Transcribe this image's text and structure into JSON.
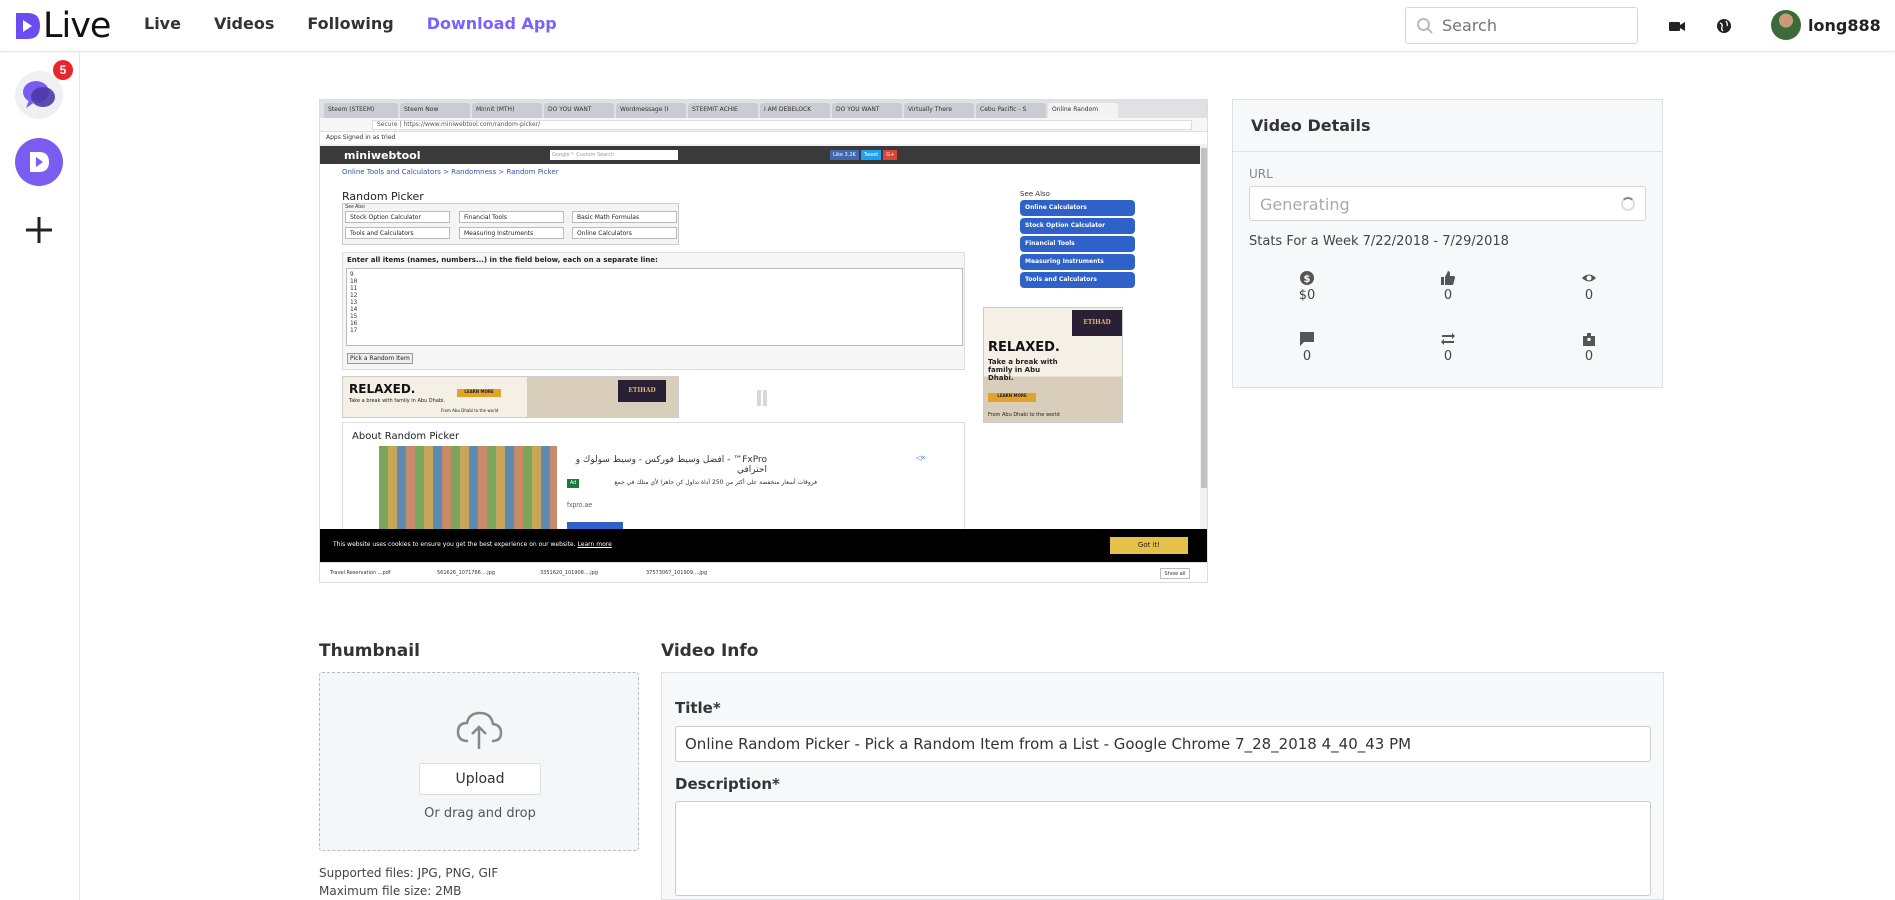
{
  "header": {
    "logo_text": "Live",
    "nav": [
      "Live",
      "Videos",
      "Following",
      "Download App"
    ],
    "search_placeholder": "Search",
    "username": "long888"
  },
  "sidebar": {
    "chat_badge": "5"
  },
  "preview": {
    "tabs": [
      "Steem (STEEM)",
      "Steem Now",
      "Minnit (MTH)",
      "DO YOU WANT",
      "Wordmessage (I",
      "STEEMIT ACHIE",
      "I AM DEBELOCK",
      "DO YOU WANT",
      "Virtually There",
      "Cebu Pacific - S",
      "Online Random"
    ],
    "url": "Secure | https://www.miniwebtool.com/random-picker/",
    "bookmarks": "Apps  Signed in as tried",
    "brand": "miniwebtool",
    "gsearch": "Google™ Custom Search",
    "share": [
      "Like 3.2K",
      "Tweet",
      "G+"
    ],
    "crumb": "Online Tools and Calculators > Randomness > Random Picker",
    "page_title": "Random Picker",
    "see_also": "See Also",
    "links": [
      "Stock Option Calculator",
      "Financial Tools",
      "Basic Math Formulas",
      "Tools and Calculators",
      "Measuring Instruments",
      "Online Calculators"
    ],
    "form_label": "Enter all items (names, numbers...) in the field below, each on a separate line:",
    "textarea": "9\n10\n11\n12\n13\n14\n15\n16\n17",
    "pick_button": "Pick a Random Item",
    "side_buttons": [
      "Online Calculators",
      "Stock Option Calculator",
      "Financial Tools",
      "Measuring Instruments",
      "Tools and Calculators"
    ],
    "ad_big": "RELAXED.",
    "ad_small": "Take a break with family in Abu Dhabi.",
    "ad_btn": "LEARN MORE",
    "ad_logo": "ETIHAD",
    "ad_from": "From Abu Dhabi to the world",
    "about_title": "About Random Picker",
    "fxpro_title": "FxPro™ - افضل وسيط فوركس - وسيط سولوك و احترافي",
    "fxpro_desc": "فروقات أسعار منخفضة على أكثر من 250 أداة تداول كن جاهزا لأي متلك في جمع",
    "fxpro_ad": "Ad",
    "fxpro_url": "fxpro.ae",
    "cookie_text": "This website uses cookies to ensure you get the best experience on our website.",
    "cookie_link": "Learn more",
    "cookie_btn": "Got it!",
    "downloads": [
      "Travel Reservation ...pdf",
      "561626_1071766....jpg",
      "3351620_101908....jpg",
      "37573067_101909....jpg"
    ],
    "show_all": "Show all"
  },
  "details": {
    "title": "Video Details",
    "url_label": "URL",
    "url_value": "Generating",
    "stats_title": "Stats For a Week 7/22/2018 - 7/29/2018",
    "stats": {
      "earnings": "$0",
      "likes": "0",
      "views": "0",
      "comments": "0",
      "reposts": "0",
      "gifts": "0"
    }
  },
  "thumbnail": {
    "title": "Thumbnail",
    "upload_label": "Upload",
    "drag_text": "Or drag and drop",
    "supported": "Supported files: JPG, PNG, GIF",
    "max_size": "Maximum file size: 2MB"
  },
  "video_info": {
    "title": "Video Info",
    "title_label": "Title*",
    "title_value": "Online Random Picker - Pick a Random Item from a List - Google Chrome 7_28_2018 4_40_43 PM",
    "description_label": "Description*",
    "description_value": ""
  },
  "colors": {
    "accent": "#7b61ff",
    "badge": "#e8262d",
    "logo": "#6a4cf0"
  }
}
